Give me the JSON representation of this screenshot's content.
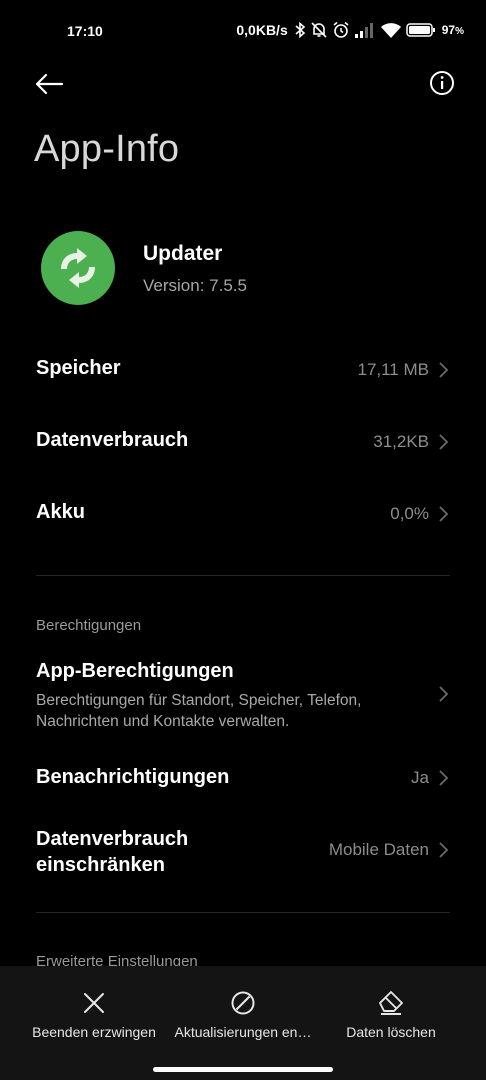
{
  "status": {
    "time": "17:10",
    "speed": "0,0KB/s",
    "battery": "97",
    "battery_unit": "%"
  },
  "header": {
    "title": "App-Info"
  },
  "app": {
    "name": "Updater",
    "version": "Version: 7.5.5",
    "icon_color": "#4caf50"
  },
  "rows": [
    {
      "label": "Speicher",
      "value": "17,11 MB"
    },
    {
      "label": "Datenverbrauch",
      "value": "31,2KB"
    },
    {
      "label": "Akku",
      "value": "0,0%"
    }
  ],
  "permissions_section": {
    "header": "Berechtigungen",
    "app_permissions": {
      "label": "App-Berechtigungen",
      "desc_line1": "Berechtigungen für Standort, Speicher, Telefon,",
      "desc_line2": "Nachrichten und Kontakte verwalten."
    },
    "notifications": {
      "label": "Benachrichtigungen",
      "value": "Ja"
    },
    "restrict_data": {
      "label_line1": "Datenverbrauch",
      "label_line2": "einschränken",
      "value": "Mobile Daten"
    }
  },
  "advanced_section": {
    "header": "Erweiterte Einstellungen"
  },
  "bottom_actions": [
    {
      "label": "Beenden erzwingen",
      "icon": "close-icon"
    },
    {
      "label": "Aktualisierungen en…",
      "icon": "block-icon"
    },
    {
      "label": "Daten löschen",
      "icon": "eraser-icon"
    }
  ],
  "colors": {
    "background": "#000000",
    "bottom_bar": "#141414",
    "secondary_text": "#8d8d8d"
  }
}
